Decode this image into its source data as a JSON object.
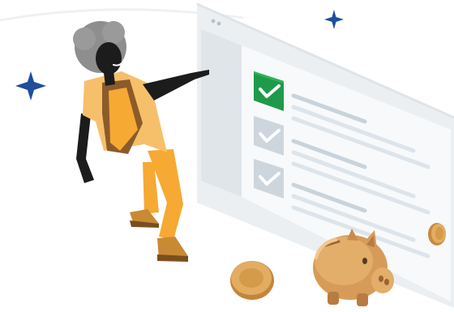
{
  "illustration": {
    "subject": "person-pointing-at-checklist-with-piggy-bank",
    "icons": [
      "sparkle-icon",
      "check-icon",
      "piggy-bank-icon",
      "coin-icon"
    ],
    "checklist": {
      "items": [
        {
          "checked": true,
          "state": "active"
        },
        {
          "checked": true,
          "state": "inactive"
        },
        {
          "checked": true,
          "state": "inactive"
        }
      ]
    },
    "colors": {
      "accent_green": "#1f9a4a",
      "sparkle_blue": "#1f4e9b",
      "coin_gold": "#d39b4a",
      "piggy_gold": "#d69b58",
      "shirt_orange": "#f6a933",
      "vest_brown": "#8c5b2b",
      "skin_dark": "#1c1c1c",
      "hair_gray": "#8e8e8e",
      "screen_frame": "#e9ecef",
      "screen_panel": "#f5f7f9",
      "inactive_check": "#cdd6dd"
    }
  }
}
